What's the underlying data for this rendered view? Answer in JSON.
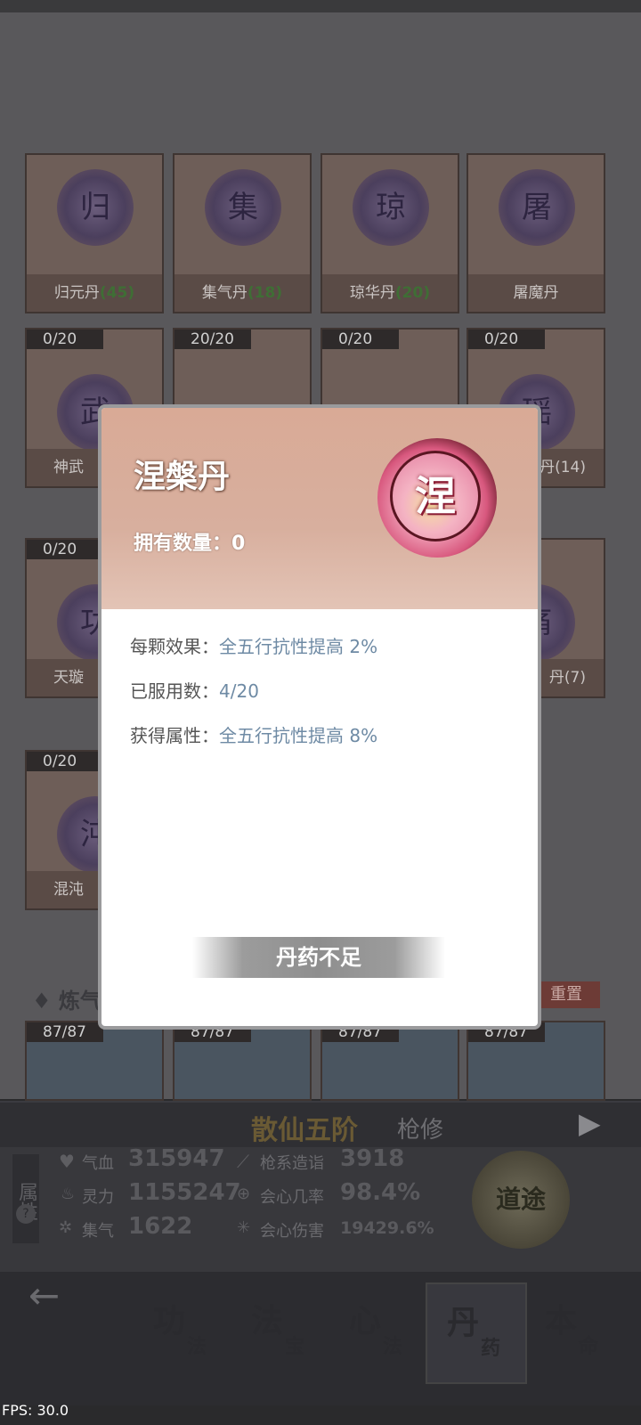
{
  "background": {
    "cards_row1": [
      {
        "char": "归",
        "name": "归元丹",
        "qty": "(45)"
      },
      {
        "char": "集",
        "name": "集气丹",
        "qty": "(18)"
      },
      {
        "char": "琼",
        "name": "琼华丹",
        "qty": "(20)"
      },
      {
        "char": "屠",
        "name": "屠魔丹",
        "qty": ""
      }
    ],
    "cards_row2": [
      {
        "count": "0/20",
        "char": "武",
        "name": "神武"
      },
      {
        "count": "20/20"
      },
      {
        "count": "0/20"
      },
      {
        "count": "0/20",
        "char": "瑶",
        "name": "丹(14)"
      }
    ],
    "cards_row3": [
      {
        "count": "0/20",
        "char": "功",
        "name": "天璇"
      },
      {
        "count": ""
      },
      {
        "count": ""
      },
      {
        "count": "",
        "char": "痛",
        "name": "丹(7)"
      }
    ],
    "cards_row4": [
      {
        "count": "0/20",
        "char": "沌",
        "name": "混沌"
      }
    ],
    "section_label": "炼气",
    "reset_label": "重置",
    "cards_row5": [
      {
        "count": "87/87"
      },
      {
        "count": "87/87"
      },
      {
        "count": "87/87"
      },
      {
        "count": "87/87"
      }
    ]
  },
  "realm": {
    "title": "散仙五阶",
    "subtitle": "枪修"
  },
  "stats": {
    "side_label": "属性",
    "help": "?",
    "items": [
      {
        "label": "气血",
        "value": "315947"
      },
      {
        "label": "灵力",
        "value": "1155247"
      },
      {
        "label": "集气",
        "value": "1622"
      },
      {
        "label": "枪系造诣",
        "value": "3918"
      },
      {
        "label": "会心几率",
        "value": "98.4%"
      },
      {
        "label": "会心伤害",
        "value": "19429.6%"
      }
    ],
    "dao_badge": "道途"
  },
  "nav": {
    "back": "←",
    "tabs": [
      {
        "big": "功",
        "small": "法"
      },
      {
        "big": "法",
        "small": "宝"
      },
      {
        "big": "心",
        "small": "法"
      },
      {
        "big": "丹",
        "small": "药"
      },
      {
        "big": "本",
        "small": "命"
      }
    ]
  },
  "popup": {
    "title": "涅槃丹",
    "pill_char": "涅",
    "own_label": "拥有数量：",
    "own_value": "0",
    "effect_label": "每颗效果：",
    "effect_value": "全五行抗性提高 2%",
    "used_label": "已服用数：",
    "used_value": "4/20",
    "gained_label": "获得属性：",
    "gained_value": "全五行抗性提高 8%",
    "button": "丹药不足"
  },
  "fps": "FPS: 30.0"
}
